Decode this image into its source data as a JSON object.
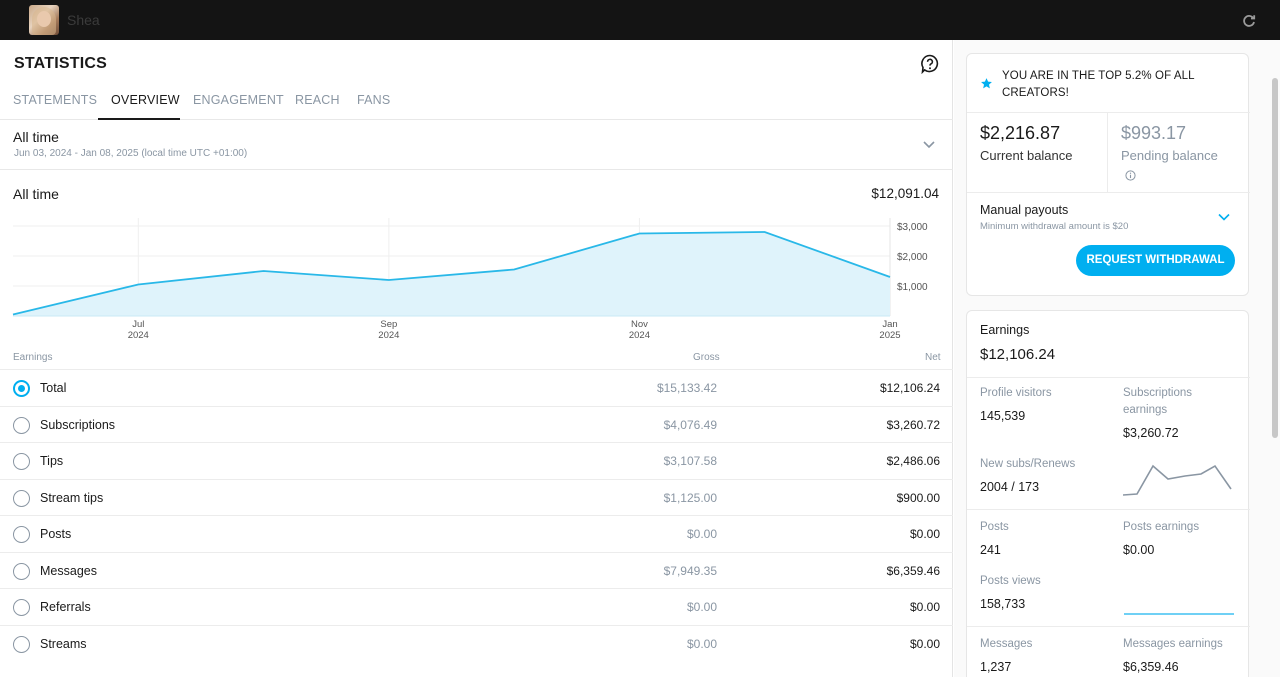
{
  "topbar": {
    "username": "Shea"
  },
  "page": {
    "title": "STATISTICS"
  },
  "tabs": [
    {
      "label": "STATEMENTS"
    },
    {
      "label": "OVERVIEW"
    },
    {
      "label": "ENGAGEMENT"
    },
    {
      "label": "REACH"
    },
    {
      "label": "FANS"
    }
  ],
  "period": {
    "title": "All time",
    "range": "Jun 03, 2024 - Jan 08, 2025 (local time UTC +01:00)"
  },
  "summary": {
    "label": "All time",
    "value": "$12,091.04"
  },
  "chart_data": {
    "type": "area",
    "x": [
      "Jun 2024",
      "Jul 2024",
      "Aug 2024",
      "Sep 2024",
      "Oct 2024",
      "Nov 2024",
      "Dec 2024",
      "Jan 2025"
    ],
    "y": [
      50,
      1050,
      1500,
      1200,
      1550,
      2750,
      2800,
      1300
    ],
    "x_ticks": [
      {
        "month": "Jul",
        "year": "2024"
      },
      {
        "month": "Sep",
        "year": "2024"
      },
      {
        "month": "Nov",
        "year": "2024"
      },
      {
        "month": "Jan",
        "year": "2025"
      }
    ],
    "y_ticks": [
      "$3,000",
      "$2,000",
      "$1,000"
    ],
    "ylim": [
      0,
      3000
    ],
    "line_color": "#29b8e8",
    "fill_color": "#dff3fb"
  },
  "table": {
    "headers": {
      "earnings": "Earnings",
      "gross": "Gross",
      "net": "Net"
    },
    "rows": [
      {
        "label": "Total",
        "gross": "$15,133.42",
        "net": "$12,106.24",
        "checked": true
      },
      {
        "label": "Subscriptions",
        "gross": "$4,076.49",
        "net": "$3,260.72",
        "checked": false
      },
      {
        "label": "Tips",
        "gross": "$3,107.58",
        "net": "$2,486.06",
        "checked": false
      },
      {
        "label": "Stream tips",
        "gross": "$1,125.00",
        "net": "$900.00",
        "checked": false
      },
      {
        "label": "Posts",
        "gross": "$0.00",
        "net": "$0.00",
        "checked": false
      },
      {
        "label": "Messages",
        "gross": "$7,949.35",
        "net": "$6,359.46",
        "checked": false
      },
      {
        "label": "Referrals",
        "gross": "$0.00",
        "net": "$0.00",
        "checked": false
      },
      {
        "label": "Streams",
        "gross": "$0.00",
        "net": "$0.00",
        "checked": false
      }
    ]
  },
  "sidebar": {
    "banner": "YOU ARE IN THE TOP 5.2% OF ALL CREATORS!",
    "current_balance": {
      "amount": "$2,216.87",
      "label": "Current balance"
    },
    "pending_balance": {
      "amount": "$993.17",
      "label": "Pending balance"
    },
    "payouts": {
      "title": "Manual payouts",
      "subtitle": "Minimum withdrawal amount is $20",
      "button": "REQUEST WITHDRAWAL"
    },
    "earnings": {
      "title": "Earnings",
      "value": "$12,106.24",
      "profile_visitors": {
        "label": "Profile visitors",
        "value": "145,539"
      },
      "subscriptions_earnings": {
        "label": "Subscriptions earnings",
        "value": "$3,260.72"
      },
      "new_subs": {
        "label": "New subs/Renews",
        "value": "2004 / 173"
      },
      "posts": {
        "label": "Posts",
        "value": "241"
      },
      "posts_earnings": {
        "label": "Posts earnings",
        "value": "$0.00"
      },
      "posts_views": {
        "label": "Posts views",
        "value": "158,733"
      },
      "messages": {
        "label": "Messages",
        "value": "1,237"
      },
      "messages_earnings": {
        "label": "Messages earnings",
        "value": "$6,359.46"
      }
    },
    "accent_color": "#00aff0"
  }
}
